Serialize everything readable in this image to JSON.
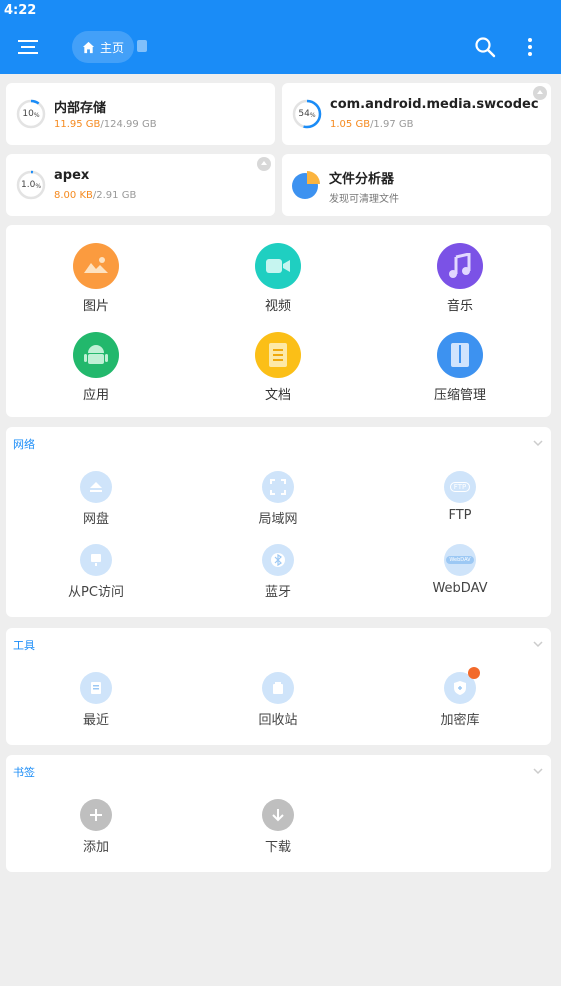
{
  "status_bar": {
    "time": "4:22"
  },
  "appbar": {
    "breadcrumb_home": "主页"
  },
  "storage": [
    {
      "name": "内部存储",
      "percent": "10",
      "percent_unit": "%",
      "used": "11.95 GB",
      "total": "/124.99 GB",
      "ratio": 0.1,
      "ejectable": false
    },
    {
      "name": "com.android.media.swcodec",
      "percent": "54",
      "percent_unit": "%",
      "used": "1.05 GB",
      "total": "/1.97 GB",
      "ratio": 0.54,
      "ejectable": true
    },
    {
      "name": "apex",
      "percent": "1.0",
      "percent_unit": "%",
      "used": "8.00 KB",
      "total": "/2.91 GB",
      "ratio": 0.01,
      "ejectable": true
    },
    {
      "name": "文件分析器",
      "subtitle": "发现可清理文件"
    }
  ],
  "categories": [
    {
      "label": "图片",
      "icon": "image-icon",
      "color": "#fb9b3f"
    },
    {
      "label": "视频",
      "icon": "video-icon",
      "color": "#1fcfc1"
    },
    {
      "label": "音乐",
      "icon": "music-icon",
      "color": "#7b52e6"
    },
    {
      "label": "应用",
      "icon": "android-icon",
      "color": "#22b86c"
    },
    {
      "label": "文档",
      "icon": "document-icon",
      "color": "#fbbf17"
    },
    {
      "label": "压缩管理",
      "icon": "archive-icon",
      "color": "#3d92f0"
    }
  ],
  "network": {
    "title": "网络",
    "items": [
      {
        "label": "网盘",
        "icon": "cloud-drive-icon"
      },
      {
        "label": "局域网",
        "icon": "lan-icon"
      },
      {
        "label": "FTP",
        "icon": "ftp-icon",
        "badge": "FTP"
      },
      {
        "label": "从PC访问",
        "icon": "pc-access-icon"
      },
      {
        "label": "蓝牙",
        "icon": "bluetooth-icon"
      },
      {
        "label": "WebDAV",
        "icon": "webdav-icon",
        "badge": "WebDAV"
      }
    ]
  },
  "tools": {
    "title": "工具",
    "items": [
      {
        "label": "最近",
        "icon": "recent-icon"
      },
      {
        "label": "回收站",
        "icon": "recycle-bin-icon"
      },
      {
        "label": "加密库",
        "icon": "vault-icon"
      }
    ]
  },
  "bookmarks": {
    "title": "书签",
    "items": [
      {
        "label": "添加",
        "icon": "add-icon"
      },
      {
        "label": "下载",
        "icon": "download-icon"
      }
    ]
  },
  "colors": {
    "accent": "#1a8cf7",
    "used": "#f58a1f",
    "background": "#eeeeee"
  }
}
